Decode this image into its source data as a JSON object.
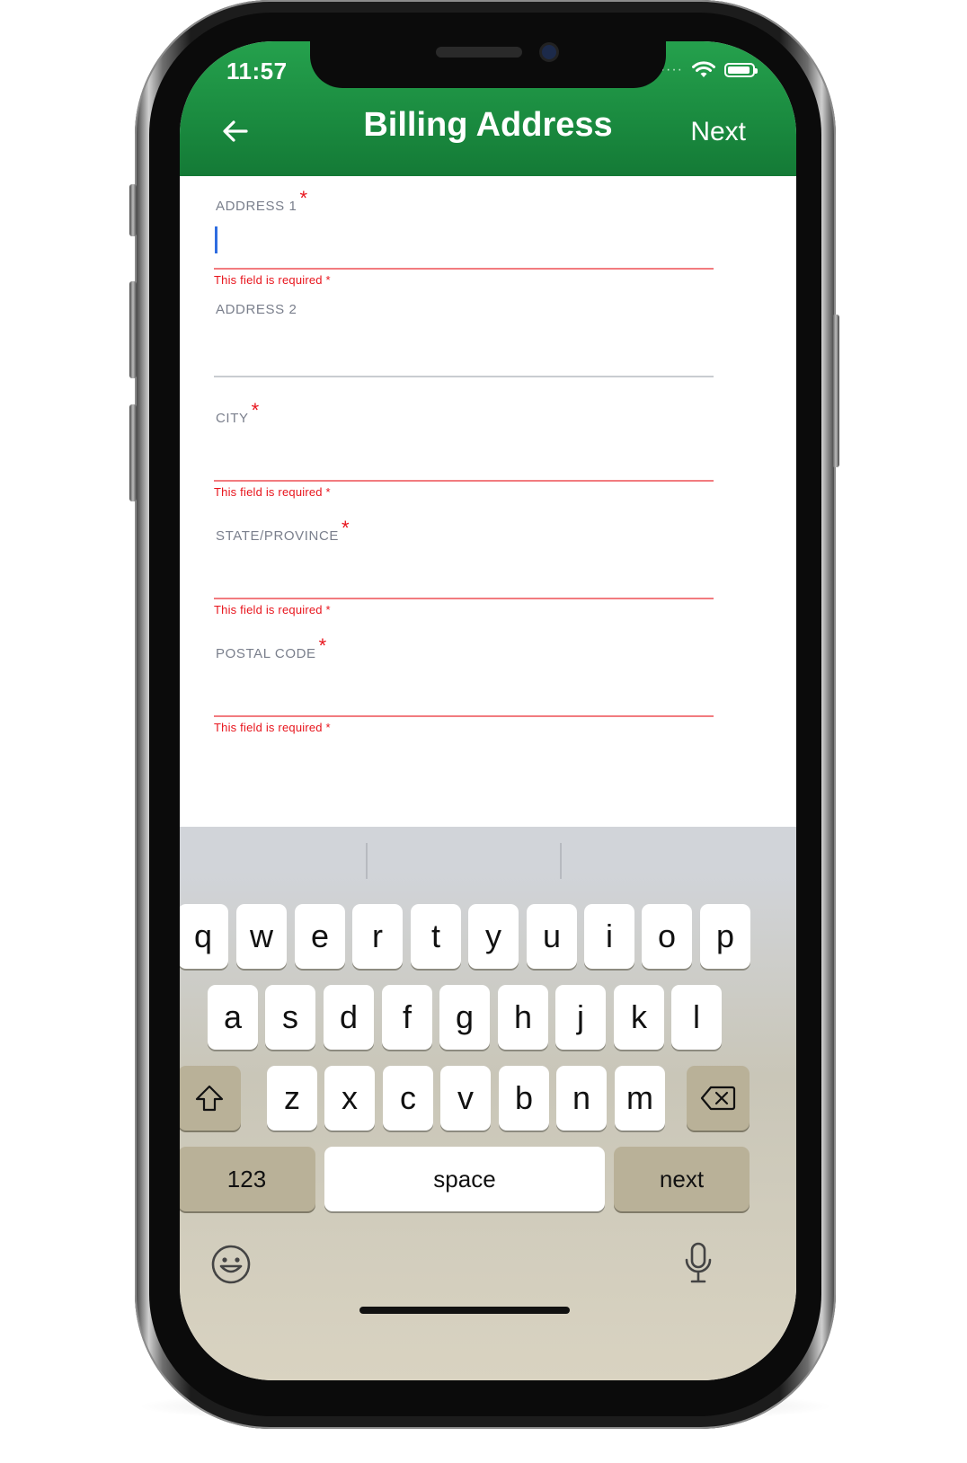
{
  "status_bar": {
    "time": "11:57",
    "signal": "····"
  },
  "header": {
    "title": "Billing Address",
    "next_label": "Next",
    "back_icon": "arrow-left-icon",
    "accent_color": "#1e8f43"
  },
  "form": {
    "required_marker": "*",
    "fields": [
      {
        "label": "ADDRESS 1",
        "required": true,
        "value": "",
        "error": "This field is required *",
        "focused": true
      },
      {
        "label": "ADDRESS 2",
        "required": false,
        "value": "",
        "error": ""
      },
      {
        "label": "CITY",
        "required": true,
        "value": "",
        "error": "This field is required *"
      },
      {
        "label": "STATE/PROVINCE",
        "required": true,
        "value": "",
        "error": "This field is required *"
      },
      {
        "label": "POSTAL CODE",
        "required": true,
        "value": "",
        "error": "This field is required *"
      }
    ],
    "error_color": "#e8141c"
  },
  "keyboard": {
    "row1": [
      "q",
      "w",
      "e",
      "r",
      "t",
      "y",
      "u",
      "i",
      "o",
      "p"
    ],
    "row2": [
      "a",
      "s",
      "d",
      "f",
      "g",
      "h",
      "j",
      "k",
      "l"
    ],
    "row3": [
      "z",
      "x",
      "c",
      "v",
      "b",
      "n",
      "m"
    ],
    "numbers_label": "123",
    "space_label": "space",
    "return_label": "next",
    "shift_icon": "shift-icon",
    "delete_icon": "delete-icon",
    "emoji_icon": "emoji-icon",
    "mic_icon": "microphone-icon"
  }
}
